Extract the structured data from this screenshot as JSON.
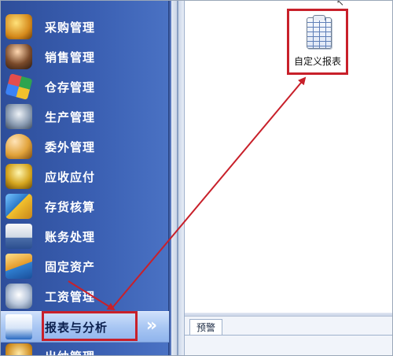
{
  "sidebar": {
    "items": [
      {
        "label": "采购管理",
        "icon": "purchasing-icon",
        "style": "ico-a"
      },
      {
        "label": "销售管理",
        "icon": "sales-icon",
        "style": "ico-b"
      },
      {
        "label": "仓存管理",
        "icon": "warehouse-icon",
        "style": "ico-c"
      },
      {
        "label": "生产管理",
        "icon": "production-icon",
        "style": "ico-d"
      },
      {
        "label": "委外管理",
        "icon": "outsourcing-icon",
        "style": "ico-e"
      },
      {
        "label": "应收应付",
        "icon": "receivable-payable-icon",
        "style": "ico-f"
      },
      {
        "label": "存货核算",
        "icon": "inventory-accounting-icon",
        "style": "ico-g"
      },
      {
        "label": "账务处理",
        "icon": "accounting-icon",
        "style": "ico-h"
      },
      {
        "label": "固定资产",
        "icon": "fixed-assets-icon",
        "style": "ico-i"
      },
      {
        "label": "工资管理",
        "icon": "payroll-icon",
        "style": "ico-j"
      },
      {
        "label": "报表与分析",
        "icon": "reports-icon",
        "style": "ico-k",
        "active": true
      },
      {
        "label": "出纳管理",
        "icon": "cashier-icon",
        "style": "ico-l"
      }
    ],
    "active_chevron": "»"
  },
  "content": {
    "tiles": [
      {
        "label": "自定义报表",
        "icon": "custom-report-icon"
      }
    ]
  },
  "bottom_panel": {
    "tabs": [
      {
        "label": "预警"
      }
    ]
  },
  "colors": {
    "sidebar_bg": "#3a5fb2",
    "highlight": "#c8202a",
    "active_item_bg": "#a9c7f3"
  }
}
